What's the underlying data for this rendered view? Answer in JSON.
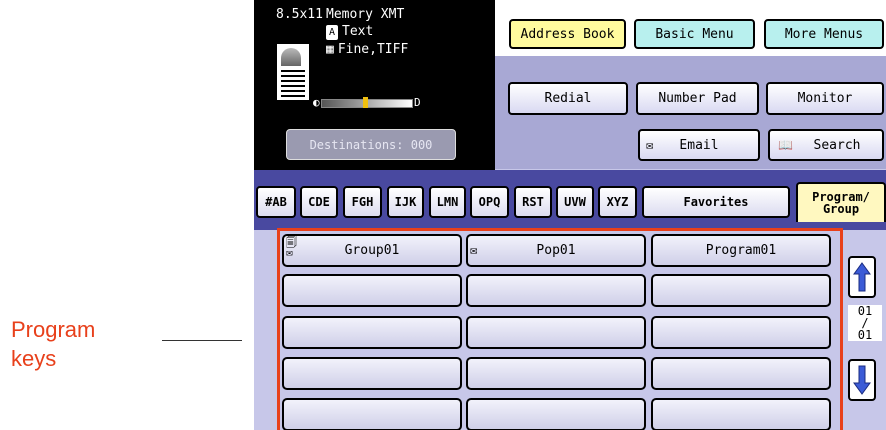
{
  "annotation": {
    "line1": "Program",
    "line2": "keys"
  },
  "status": {
    "paper": "8.5x11",
    "mode": "Memory XMT",
    "text_mode": "Text",
    "resolution": "Fine,TIFF",
    "density_left": "◐",
    "density_right": "D",
    "destinations": "Destinations: 000"
  },
  "top_buttons": {
    "address_book": "Address Book",
    "basic_menu": "Basic Menu",
    "more_menus": "More Menus",
    "redial": "Redial",
    "number_pad": "Number Pad",
    "monitor": "Monitor",
    "email": "Email",
    "search": "Search"
  },
  "tabs": [
    "#AB",
    "CDE",
    "FGH",
    "IJK",
    "LMN",
    "OPQ",
    "RST",
    "UVW",
    "XYZ",
    "Favorites",
    "Program/ Group"
  ],
  "keys": [
    {
      "label": "Group01",
      "icon": "group-icon"
    },
    {
      "label": "Pop01",
      "icon": "email-icon"
    },
    {
      "label": "Program01",
      "icon": ""
    }
  ],
  "pager": {
    "current": "01",
    "separator": "/",
    "total": "01"
  },
  "colors": {
    "accent": "#e8401b",
    "address_book_bg": "#fffb9e",
    "teal_buttons": "#b8f0ee",
    "tab_bar": "#4949a0"
  }
}
